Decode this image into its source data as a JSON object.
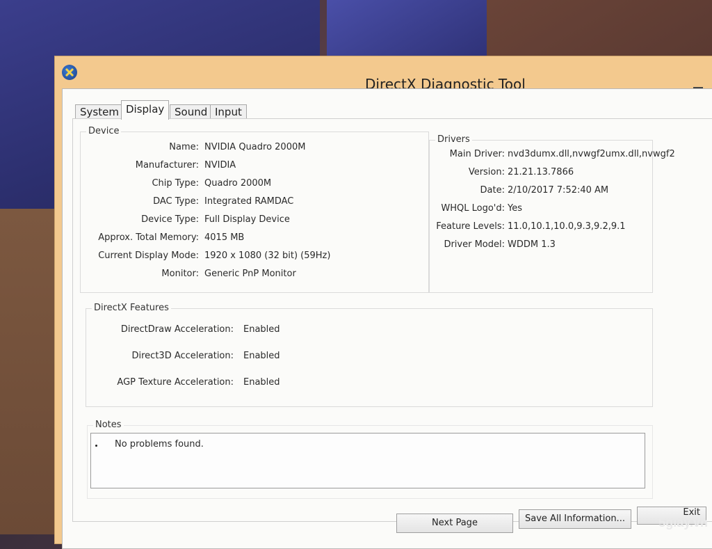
{
  "window": {
    "title": "DirectX Diagnostic Tool"
  },
  "tabs": [
    "System",
    "Display",
    "Sound",
    "Input"
  ],
  "device": {
    "label": "Device",
    "fields": [
      {
        "label": "Name:",
        "value": "NVIDIA Quadro 2000M"
      },
      {
        "label": "Manufacturer:",
        "value": "NVIDIA"
      },
      {
        "label": "Chip Type:",
        "value": "Quadro 2000M"
      },
      {
        "label": "DAC Type:",
        "value": "Integrated RAMDAC"
      },
      {
        "label": "Device Type:",
        "value": "Full Display Device"
      },
      {
        "label": "Approx. Total Memory:",
        "value": "4015 MB"
      },
      {
        "label": "Current Display Mode:",
        "value": "1920 x 1080 (32 bit) (59Hz)"
      },
      {
        "label": "Monitor:",
        "value": "Generic PnP Monitor"
      }
    ]
  },
  "drivers": {
    "label": "Drivers",
    "fields": [
      {
        "label": "Main Driver:",
        "value": "nvd3dumx.dll,nvwgf2umx.dll,nvwgf2"
      },
      {
        "label": "Version:",
        "value": "21.21.13.7866"
      },
      {
        "label": "Date:",
        "value": "2/10/2017 7:52:40 AM"
      },
      {
        "label": "WHQL Logo'd:",
        "value": "Yes"
      },
      {
        "label": "Feature Levels:",
        "value": "11.0,10.1,10.0,9.3,9.2,9.1"
      },
      {
        "label": "Driver Model:",
        "value": "WDDM 1.3"
      }
    ]
  },
  "directx_features": {
    "label": "DirectX Features",
    "fields": [
      {
        "label": "DirectDraw Acceleration:",
        "value": "Enabled"
      },
      {
        "label": "Direct3D Acceleration:",
        "value": "Enabled"
      },
      {
        "label": "AGP Texture Acceleration:",
        "value": "Enabled"
      }
    ]
  },
  "notes": {
    "label": "Notes",
    "items": [
      "No problems found."
    ]
  },
  "buttons": {
    "next_page": "Next Page",
    "save_all": "Save All Information...",
    "exit": "Exit"
  },
  "watermark": "5giay.vn"
}
